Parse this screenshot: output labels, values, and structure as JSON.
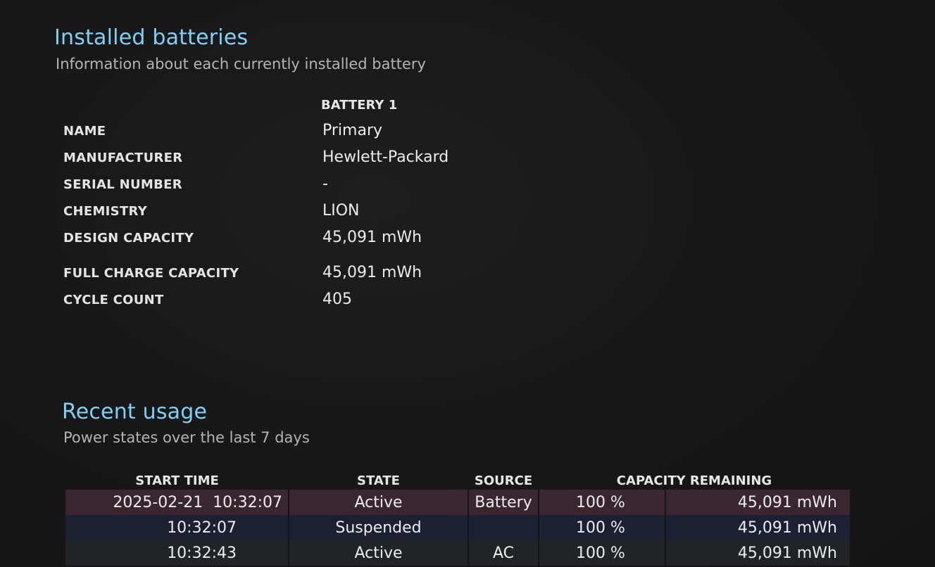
{
  "installed": {
    "title": "Installed batteries",
    "subtitle": "Information about each currently installed battery",
    "column_header": "BATTERY 1",
    "rows": [
      {
        "label": "NAME",
        "value": "Primary"
      },
      {
        "label": "MANUFACTURER",
        "value": "Hewlett-Packard"
      },
      {
        "label": "SERIAL NUMBER",
        "value": "-"
      },
      {
        "label": "CHEMISTRY",
        "value": "LION"
      },
      {
        "label": "DESIGN CAPACITY",
        "value": "45,091 mWh"
      },
      {
        "label": "FULL CHARGE CAPACITY",
        "value": "45,091 mWh"
      },
      {
        "label": "CYCLE COUNT",
        "value": "405"
      }
    ]
  },
  "usage": {
    "title": "Recent usage",
    "subtitle": "Power states over the last 7 days",
    "headers": {
      "start_time": "START TIME",
      "state": "STATE",
      "source": "SOURCE",
      "capacity_remaining": "CAPACITY REMAINING"
    },
    "rows": [
      {
        "start": "2025-02-21  10:32:07",
        "state": "Active",
        "source": "Battery",
        "percent": "100 %",
        "mwh": "45,091 mWh"
      },
      {
        "start": "10:32:07",
        "state": "Suspended",
        "source": "",
        "percent": "100 %",
        "mwh": "45,091 mWh"
      },
      {
        "start": "10:32:43",
        "state": "Active",
        "source": "AC",
        "percent": "100 %",
        "mwh": "45,091 mWh"
      }
    ]
  }
}
